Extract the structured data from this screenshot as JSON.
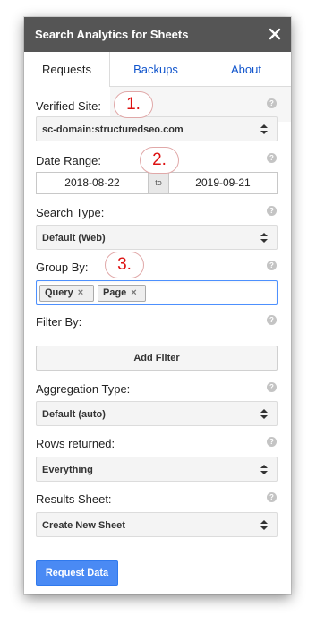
{
  "window": {
    "title": "Search Analytics for Sheets",
    "close_icon": "close-icon"
  },
  "tabs": [
    {
      "label": "Requests",
      "active": true
    },
    {
      "label": "Backups",
      "active": false
    },
    {
      "label": "About",
      "active": false
    }
  ],
  "form": {
    "verified_site": {
      "label": "Verified Site:",
      "value": "sc-domain:structuredseo.com"
    },
    "date_range": {
      "label": "Date Range:",
      "from": "2018-08-22",
      "to_label": "to",
      "to": "2019-09-21"
    },
    "search_type": {
      "label": "Search Type:",
      "value": "Default (Web)"
    },
    "group_by": {
      "label": "Group By:",
      "chips": [
        "Query",
        "Page"
      ],
      "chip_remove": "×"
    },
    "filter_by": {
      "label": "Filter By:",
      "add_filter_label": "Add Filter"
    },
    "aggregation_type": {
      "label": "Aggregation Type:",
      "value": "Default (auto)"
    },
    "rows_returned": {
      "label": "Rows returned:",
      "value": "Everything"
    },
    "results_sheet": {
      "label": "Results Sheet:",
      "value": "Create New Sheet"
    },
    "help_glyph": "?",
    "submit_label": "Request Data"
  },
  "annotations": [
    "1.",
    "2.",
    "3."
  ],
  "colors": {
    "titlebar": "#555555",
    "link": "#1155cc",
    "primary": "#4a8af4",
    "focus": "#4d90fe",
    "annotation": "#dd1111"
  }
}
